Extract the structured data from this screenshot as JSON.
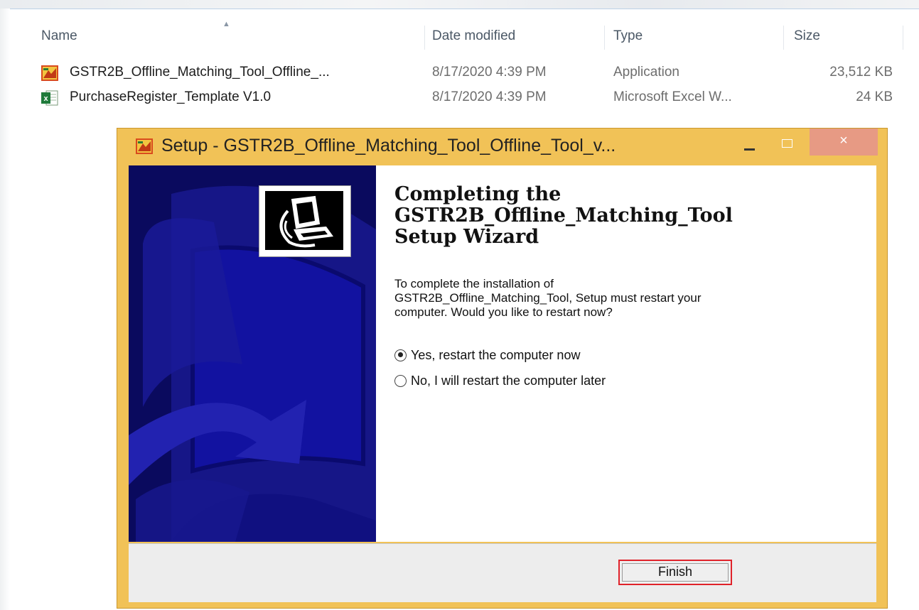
{
  "explorer": {
    "columns": {
      "name": "Name",
      "date_modified": "Date modified",
      "type": "Type",
      "size": "Size"
    },
    "files": [
      {
        "name": "GSTR2B_Offline_Matching_Tool_Offline_...",
        "date": "8/17/2020 4:39 PM",
        "type": "Application",
        "size": "23,512 KB",
        "icon": "setup-app-icon"
      },
      {
        "name": "PurchaseRegister_Template V1.0",
        "date": "8/17/2020 4:39 PM",
        "type": "Microsoft Excel W...",
        "size": "24 KB",
        "icon": "excel-file-icon"
      }
    ]
  },
  "dialog": {
    "title": "Setup - GSTR2B_Offline_Matching_Tool_Offline_Tool_v...",
    "close_label": "×",
    "heading": [
      "Completing the",
      "GSTR2B_Offline_Matching_Tool",
      "Setup Wizard"
    ],
    "description": [
      "To complete the installation of",
      "GSTR2B_Offline_Matching_Tool, Setup must restart your",
      "computer. Would you like to restart now?"
    ],
    "options": [
      {
        "label": "Yes, restart the computer now",
        "selected": true
      },
      {
        "label": "No, I will restart the computer later",
        "selected": false
      }
    ],
    "finish_label": "Finish"
  },
  "colors": {
    "title_bar": "#f1c257",
    "wizard_panel": "#0a0a5e",
    "close_button": "#e79a84",
    "highlight": "#e0222a"
  }
}
